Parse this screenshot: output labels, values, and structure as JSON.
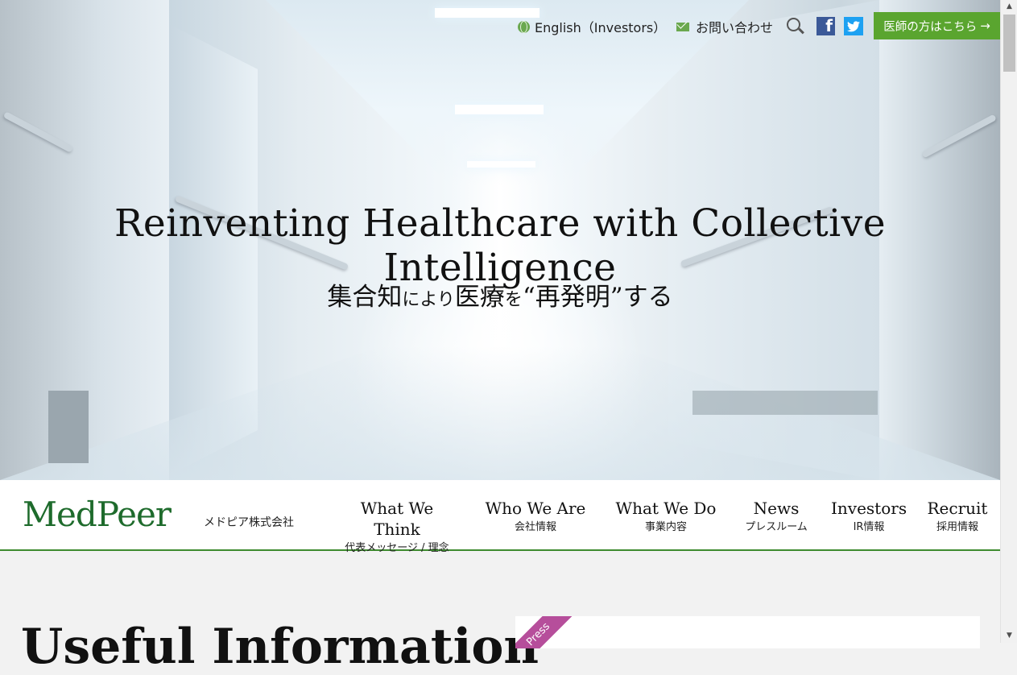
{
  "hero": {
    "title": "Reinventing Healthcare with Collective Intelligence",
    "subtitle_parts": [
      "集合知",
      "により",
      "医療",
      "を",
      "“再発明”",
      "する"
    ]
  },
  "utility": {
    "language_link": "English（Investors）",
    "contact_link": "お問い合わせ",
    "doctor_button": "医師の方はこちら",
    "doctor_arrow": "→",
    "facebook_letter": "f"
  },
  "brand": {
    "logo": "MedPeer",
    "company_name": "メドピア株式会社",
    "accent_color": "#3e8b2f",
    "button_color": "#5aa52f"
  },
  "nav": {
    "items": [
      {
        "en": "What We Think",
        "jp": "代表メッセージ / 理念"
      },
      {
        "en": "Who We Are",
        "jp": "会社情報"
      },
      {
        "en": "What We Do",
        "jp": "事業内容"
      },
      {
        "en": "News",
        "jp": "プレスルーム"
      },
      {
        "en": "Investors",
        "jp": "IR情報"
      },
      {
        "en": "Recruit",
        "jp": "採用情報"
      }
    ]
  },
  "content": {
    "heading": "Useful Information",
    "press_tag": "Press"
  },
  "scrollbar": {
    "up": "▲",
    "down": "▼"
  }
}
